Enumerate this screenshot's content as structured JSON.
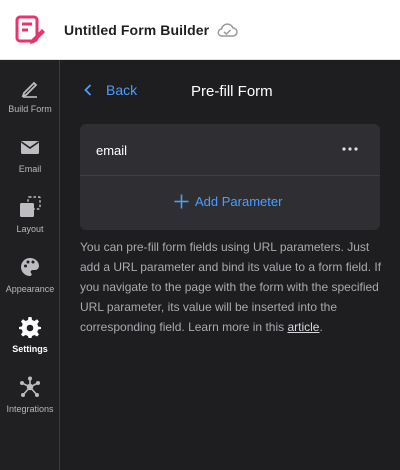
{
  "app": {
    "title": "Untitled Form Builder",
    "logo_icon": "form-logo-icon",
    "sync_icon": "cloud-check-icon",
    "brand_color": "#e8336d"
  },
  "sidebar": {
    "items": [
      {
        "label": "Build Form",
        "icon": "pencil-icon",
        "active": false
      },
      {
        "label": "Email",
        "icon": "envelope-icon",
        "active": false
      },
      {
        "label": "Layout",
        "icon": "layout-icon",
        "active": false
      },
      {
        "label": "Appearance",
        "icon": "palette-icon",
        "active": false
      },
      {
        "label": "Settings",
        "icon": "gear-icon",
        "active": true
      },
      {
        "label": "Integrations",
        "icon": "integrations-icon",
        "active": false
      }
    ]
  },
  "panel": {
    "back_label": "Back",
    "title": "Pre-fill Form",
    "parameters": [
      {
        "name": "email"
      }
    ],
    "add_parameter_label": "Add Parameter",
    "help_text": "You can pre-fill form fields using URL parameters. Just add a URL parameter and bind its value to a form field. If you navigate to the page with the form with the specified URL parameter, its value will be inserted into the corresponding field. Learn more in this ",
    "help_link": "article",
    "help_suffix": ".",
    "accent_color": "#4a9eff"
  }
}
